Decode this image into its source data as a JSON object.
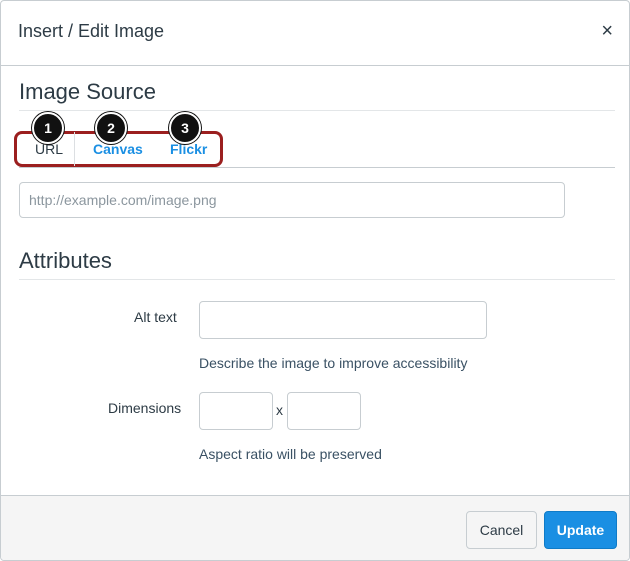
{
  "dialog": {
    "title": "Insert / Edit Image",
    "close_glyph": "×"
  },
  "image_source": {
    "heading": "Image Source",
    "tabs": [
      {
        "label": "URL",
        "badge": "1",
        "selected": true
      },
      {
        "label": "Canvas",
        "badge": "2",
        "selected": false
      },
      {
        "label": "Flickr",
        "badge": "3",
        "selected": false
      }
    ],
    "url_input": {
      "value": "",
      "placeholder": "http://example.com/image.png"
    }
  },
  "attributes": {
    "heading": "Attributes",
    "alt_text": {
      "label": "Alt text",
      "value": "",
      "help": "Describe the image to improve accessibility"
    },
    "dimensions": {
      "label": "Dimensions",
      "width_value": "",
      "height_value": "",
      "separator": "x",
      "help": "Aspect ratio will be preserved"
    }
  },
  "footer": {
    "cancel_label": "Cancel",
    "update_label": "Update"
  },
  "colors": {
    "accent": "#1a8fe3",
    "highlight_border": "#9b1f1f",
    "text": "#2d3b45"
  },
  "icons": {
    "close": "close-icon"
  }
}
